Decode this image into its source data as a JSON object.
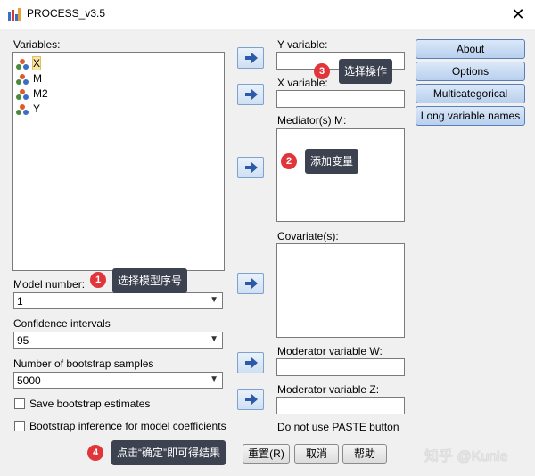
{
  "window": {
    "title": "PROCESS_v3.5",
    "close_glyph": "✕"
  },
  "variables": {
    "label": "Variables:",
    "items": [
      {
        "name": "X",
        "selected": true
      },
      {
        "name": "M",
        "selected": false
      },
      {
        "name": "M2",
        "selected": false
      },
      {
        "name": "Y",
        "selected": false
      }
    ]
  },
  "fields": {
    "y_variable": "Y variable:",
    "x_variable": "X variable:",
    "mediators": "Mediator(s) M:",
    "covariates": "Covariate(s):",
    "moderator_w": "Moderator variable W:",
    "moderator_z": "Moderator variable Z:",
    "paste_note": "Do not use PASTE button"
  },
  "side_buttons": [
    "About",
    "Options",
    "Multicategorical",
    "Long variable names"
  ],
  "model": {
    "label": "Model number:",
    "value": "1"
  },
  "confidence": {
    "label": "Confidence intervals",
    "value": "95"
  },
  "bootstrap": {
    "label": "Number of bootstrap samples",
    "value": "5000"
  },
  "checkboxes": {
    "save": "Save bootstrap estimates",
    "inference": "Bootstrap inference for model coefficients"
  },
  "bottom_buttons": {
    "reset": "重置(R)",
    "cancel": "取消",
    "help": "帮助"
  },
  "annotations": [
    {
      "num": "1",
      "text": "选择模型序号"
    },
    {
      "num": "2",
      "text": "添加变量"
    },
    {
      "num": "3",
      "text": "选择操作"
    },
    {
      "num": "4",
      "text": "点击“确定”即可得结果"
    }
  ],
  "watermark": "知乎 @Kunle",
  "colors": {
    "badge": "#e0353b",
    "tooltip": "#3d4250",
    "side_button": "#b8d0ee",
    "selection": "#f7e7a6"
  }
}
